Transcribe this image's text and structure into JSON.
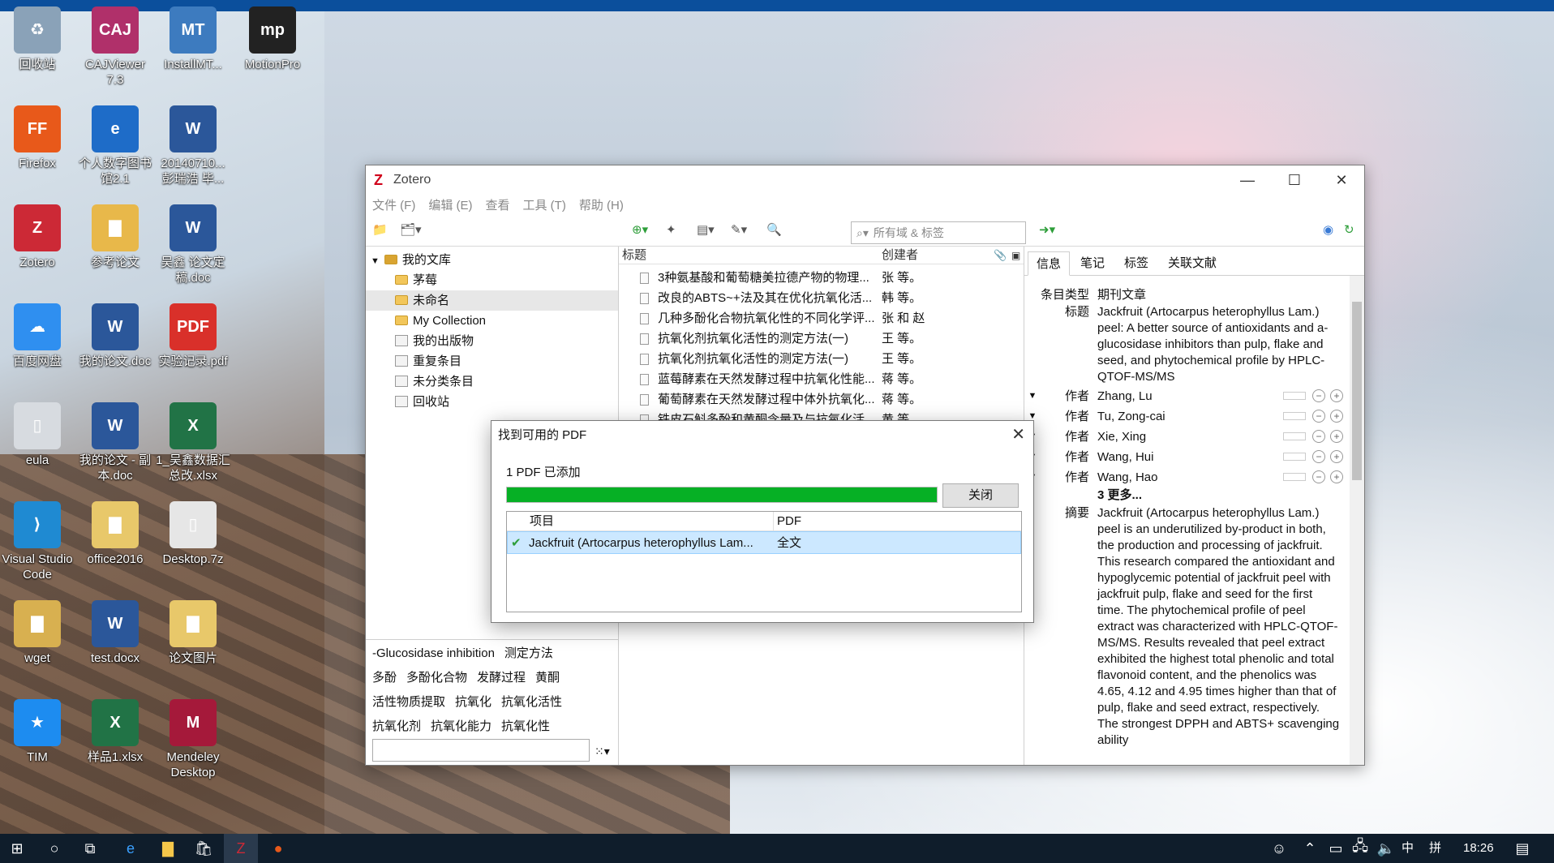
{
  "desktop": {
    "icons": [
      {
        "label": "回收站",
        "glyph": "♻",
        "color": "#8aa2b8"
      },
      {
        "label": "CAJViewer 7.3",
        "glyph": "CAJ",
        "color": "#b0306a"
      },
      {
        "label": "InstallMT...",
        "glyph": "MT",
        "color": "#3d7bbf"
      },
      {
        "label": "MotionPro",
        "glyph": "mp",
        "color": "#222222"
      },
      {
        "label": "Firefox",
        "glyph": "FF",
        "color": "#e8591a"
      },
      {
        "label": "个人数字图书馆2.1",
        "glyph": "e",
        "color": "#1e6cc8"
      },
      {
        "label": "20140710...彭瑞浩 毕...",
        "glyph": "W",
        "color": "#2b579a"
      },
      {
        "label": "Zotero",
        "glyph": "Z",
        "color": "#cc2936"
      },
      {
        "label": "参考论文",
        "glyph": "▇",
        "color": "#e8b84a"
      },
      {
        "label": "吴鑫 论文定稿.doc",
        "glyph": "W",
        "color": "#2b579a"
      },
      {
        "label": "百度网盘",
        "glyph": "☁",
        "color": "#2f8ff0"
      },
      {
        "label": "我的论文.doc",
        "glyph": "W",
        "color": "#2b579a"
      },
      {
        "label": "实验记录.pdf",
        "glyph": "PDF",
        "color": "#d9302a"
      },
      {
        "label": "eula",
        "glyph": "▯",
        "color": "#d7dbe0"
      },
      {
        "label": "我的论文 - 副本.doc",
        "glyph": "W",
        "color": "#2b579a"
      },
      {
        "label": "1_吴鑫数据汇总改.xlsx",
        "glyph": "X",
        "color": "#217346"
      },
      {
        "label": "Visual Studio Code",
        "glyph": "⟩",
        "color": "#1f8ad2"
      },
      {
        "label": "office2016",
        "glyph": "▇",
        "color": "#e8c86a"
      },
      {
        "label": "Desktop.7z",
        "glyph": "▯",
        "color": "#e6e6e6"
      },
      {
        "label": "wget",
        "glyph": "▇",
        "color": "#d8b050"
      },
      {
        "label": "test.docx",
        "glyph": "W",
        "color": "#2b579a"
      },
      {
        "label": "论文图片",
        "glyph": "▇",
        "color": "#e8c86a"
      },
      {
        "label": "TIM",
        "glyph": "★",
        "color": "#1d8cf0"
      },
      {
        "label": "样品1.xlsx",
        "glyph": "X",
        "color": "#217346"
      },
      {
        "label": "Mendeley Desktop",
        "glyph": "M",
        "color": "#a5193a"
      }
    ]
  },
  "zotero": {
    "title": "Zotero",
    "menu": [
      "文件 (F)",
      "编辑 (E)",
      "查看",
      "工具 (T)",
      "帮助 (H)"
    ],
    "search_placeholder": "所有域 & 标签",
    "collections": {
      "root": "我的文库",
      "items": [
        {
          "label": "茅莓",
          "type": "folder",
          "selected": false
        },
        {
          "label": "未命名",
          "type": "folder",
          "selected": true
        },
        {
          "label": "My Collection",
          "type": "folder",
          "selected": false
        },
        {
          "label": "我的出版物",
          "type": "special",
          "selected": false
        },
        {
          "label": "重复条目",
          "type": "special",
          "selected": false
        },
        {
          "label": "未分类条目",
          "type": "special",
          "selected": false
        },
        {
          "label": "回收站",
          "type": "special",
          "selected": false
        }
      ]
    },
    "tags": [
      [
        "-Glucosidase inhibition",
        "测定方法"
      ],
      [
        "多酚",
        "多酚化合物",
        "发酵过程",
        "黄酮"
      ],
      [
        "活性物质提取",
        "抗氧化",
        "抗氧化活性"
      ],
      [
        "抗氧化剂",
        "抗氧化能力",
        "抗氧化性"
      ]
    ],
    "items_table": {
      "col_title": "标题",
      "col_creator": "创建者",
      "rows": [
        {
          "title": "3种氨基酸和葡萄糖美拉德产物的物理...",
          "creator": "张 等。"
        },
        {
          "title": "改良的ABTS~+法及其在优化抗氧化活...",
          "creator": "韩 等。"
        },
        {
          "title": "几种多酚化合物抗氧化性的不同化学评...",
          "creator": "张 和 赵"
        },
        {
          "title": "抗氧化剂抗氧化活性的测定方法(一)",
          "creator": "王 等。"
        },
        {
          "title": "抗氧化剂抗氧化活性的测定方法(一)",
          "creator": "王 等。"
        },
        {
          "title": "蓝莓酵素在天然发酵过程中抗氧化性能...",
          "creator": "蒋 等。"
        },
        {
          "title": "葡萄酵素在天然发酵过程中体外抗氧化...",
          "creator": "蒋 等。"
        },
        {
          "title": "铁皮石斛多酚和黄酮含量及与抗氧化活...",
          "creator": "黄 等。"
        }
      ]
    },
    "detail_tabs": [
      "信息",
      "笔记",
      "标签",
      "关联文献"
    ],
    "detail": {
      "item_type_label": "条目类型",
      "item_type": "期刊文章",
      "title_label": "标题",
      "title": "Jackfruit (Artocarpus heterophyllus Lam.) peel: A better source of antioxidants and a-glucosidase inhibitors than pulp, flake and seed, and phytochemical profile by HPLC-QTOF-MS/MS",
      "author_label": "作者",
      "authors": [
        "Zhang, Lu",
        "Tu, Zong-cai",
        "Xie, Xing",
        "Wang, Hui",
        "Wang, Hao"
      ],
      "more": "3 更多...",
      "abstract_label": "摘要",
      "abstract": "Jackfruit (Artocarpus heterophyllus Lam.) peel is an underutilized by-product in both, the production and processing of jackfruit. This research compared the antioxidant and hypoglycemic potential of jackfruit peel with jackfruit pulp, flake and seed for the first time. The phytochemical profile of peel extract was characterized with HPLC-QTOF-MS/MS. Results revealed that peel extract exhibited the highest total phenolic and total flavonoid content, and the phenolics was 4.65, 4.12 and 4.95 times higher than that of pulp, flake and seed extract, respectively. The strongest DPPH and ABTS+ scavenging ability"
    }
  },
  "dialog": {
    "title": "找到可用的 PDF",
    "status": "1 PDF 已添加",
    "progress": 1.0,
    "close_button": "关闭",
    "col_item": "项目",
    "col_pdf": "PDF",
    "row_item": "Jackfruit (Artocarpus heterophyllus Lam...",
    "row_pdf": "全文"
  },
  "taskbar": {
    "ime": "中",
    "ime2": "拼",
    "time": "18:26"
  },
  "colors": {
    "accent": "#06b025",
    "taskbar": "#0f1d2b",
    "zotero_red": "#cc2936"
  }
}
